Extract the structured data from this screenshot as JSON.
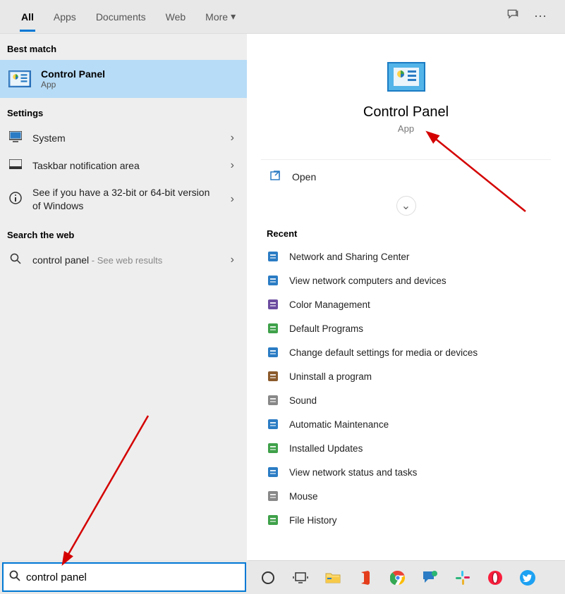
{
  "tabs": {
    "all": "All",
    "apps": "Apps",
    "documents": "Documents",
    "web": "Web",
    "more": "More"
  },
  "sections": {
    "best_match": "Best match",
    "settings": "Settings",
    "search_web": "Search the web",
    "recent": "Recent"
  },
  "best_match": {
    "title": "Control Panel",
    "subtitle": "App"
  },
  "settings_rows": [
    {
      "label": "System",
      "icon": "monitor"
    },
    {
      "label": "Taskbar notification area",
      "icon": "taskbar"
    },
    {
      "label": "See if you have a 32-bit or 64-bit version of Windows",
      "icon": "info"
    }
  ],
  "web_row": {
    "query": "control panel",
    "suffix": " - See web results"
  },
  "preview": {
    "title": "Control Panel",
    "subtitle": "App",
    "open": "Open"
  },
  "recent_items": [
    "Network and Sharing Center",
    "View network computers and devices",
    "Color Management",
    "Default Programs",
    "Change default settings for media or devices",
    "Uninstall a program",
    "Sound",
    "Automatic Maintenance",
    "Installed Updates",
    "View network status and tasks",
    "Mouse",
    "File History"
  ],
  "search": {
    "value": "control panel"
  },
  "colors": {
    "accent": "#0078d4",
    "highlight": "#b7dcf7"
  }
}
